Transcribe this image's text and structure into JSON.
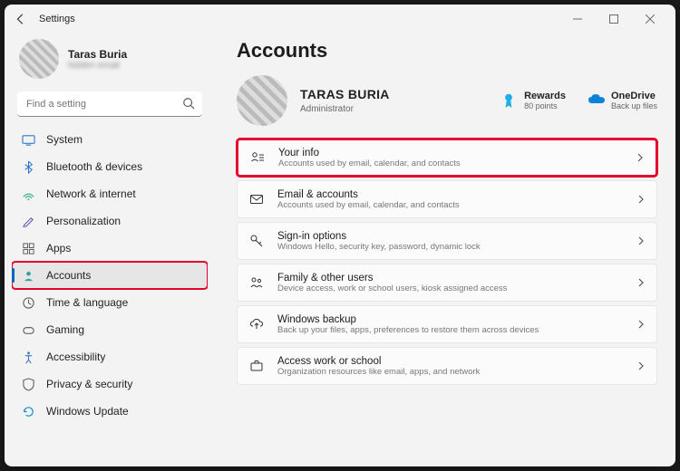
{
  "window": {
    "title": "Settings"
  },
  "user": {
    "name": "Taras Buria",
    "email": "hidden email"
  },
  "search": {
    "placeholder": "Find a setting"
  },
  "nav": {
    "items": [
      {
        "label": "System"
      },
      {
        "label": "Bluetooth & devices"
      },
      {
        "label": "Network & internet"
      },
      {
        "label": "Personalization"
      },
      {
        "label": "Apps"
      },
      {
        "label": "Accounts"
      },
      {
        "label": "Time & language"
      },
      {
        "label": "Gaming"
      },
      {
        "label": "Accessibility"
      },
      {
        "label": "Privacy & security"
      },
      {
        "label": "Windows Update"
      }
    ]
  },
  "page": {
    "title": "Accounts",
    "account_name": "TARAS BURIA",
    "account_role": "Administrator",
    "rewards": {
      "title": "Rewards",
      "sub": "80 points"
    },
    "onedrive": {
      "title": "OneDrive",
      "sub": "Back up files"
    },
    "cards": [
      {
        "title": "Your info",
        "sub": "Accounts used by email, calendar, and contacts"
      },
      {
        "title": "Email & accounts",
        "sub": "Accounts used by email, calendar, and contacts"
      },
      {
        "title": "Sign-in options",
        "sub": "Windows Hello, security key, password, dynamic lock"
      },
      {
        "title": "Family & other users",
        "sub": "Device access, work or school users, kiosk assigned access"
      },
      {
        "title": "Windows backup",
        "sub": "Back up your files, apps, preferences to restore them across devices"
      },
      {
        "title": "Access work or school",
        "sub": "Organization resources like email, apps, and network"
      }
    ]
  }
}
